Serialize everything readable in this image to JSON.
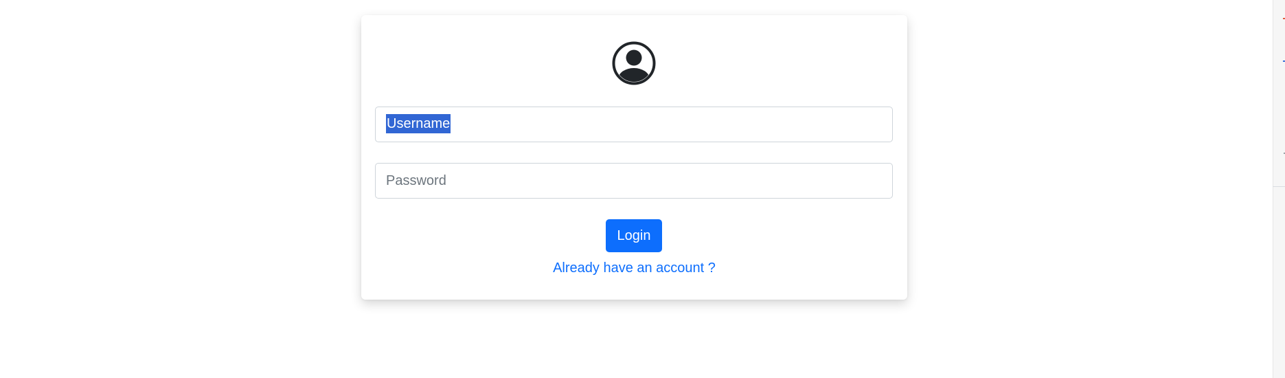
{
  "login_form": {
    "avatar_icon": "user-circle-icon",
    "username": {
      "value": "Username",
      "selected": true
    },
    "password": {
      "placeholder": "Password"
    },
    "login_label": "Login",
    "account_link": "Already have an account ?"
  },
  "colors": {
    "primary": "#0d6efd",
    "selection": "#3166d4",
    "icon": "#212529",
    "border": "#ced4da",
    "placeholder": "#6c757d"
  }
}
